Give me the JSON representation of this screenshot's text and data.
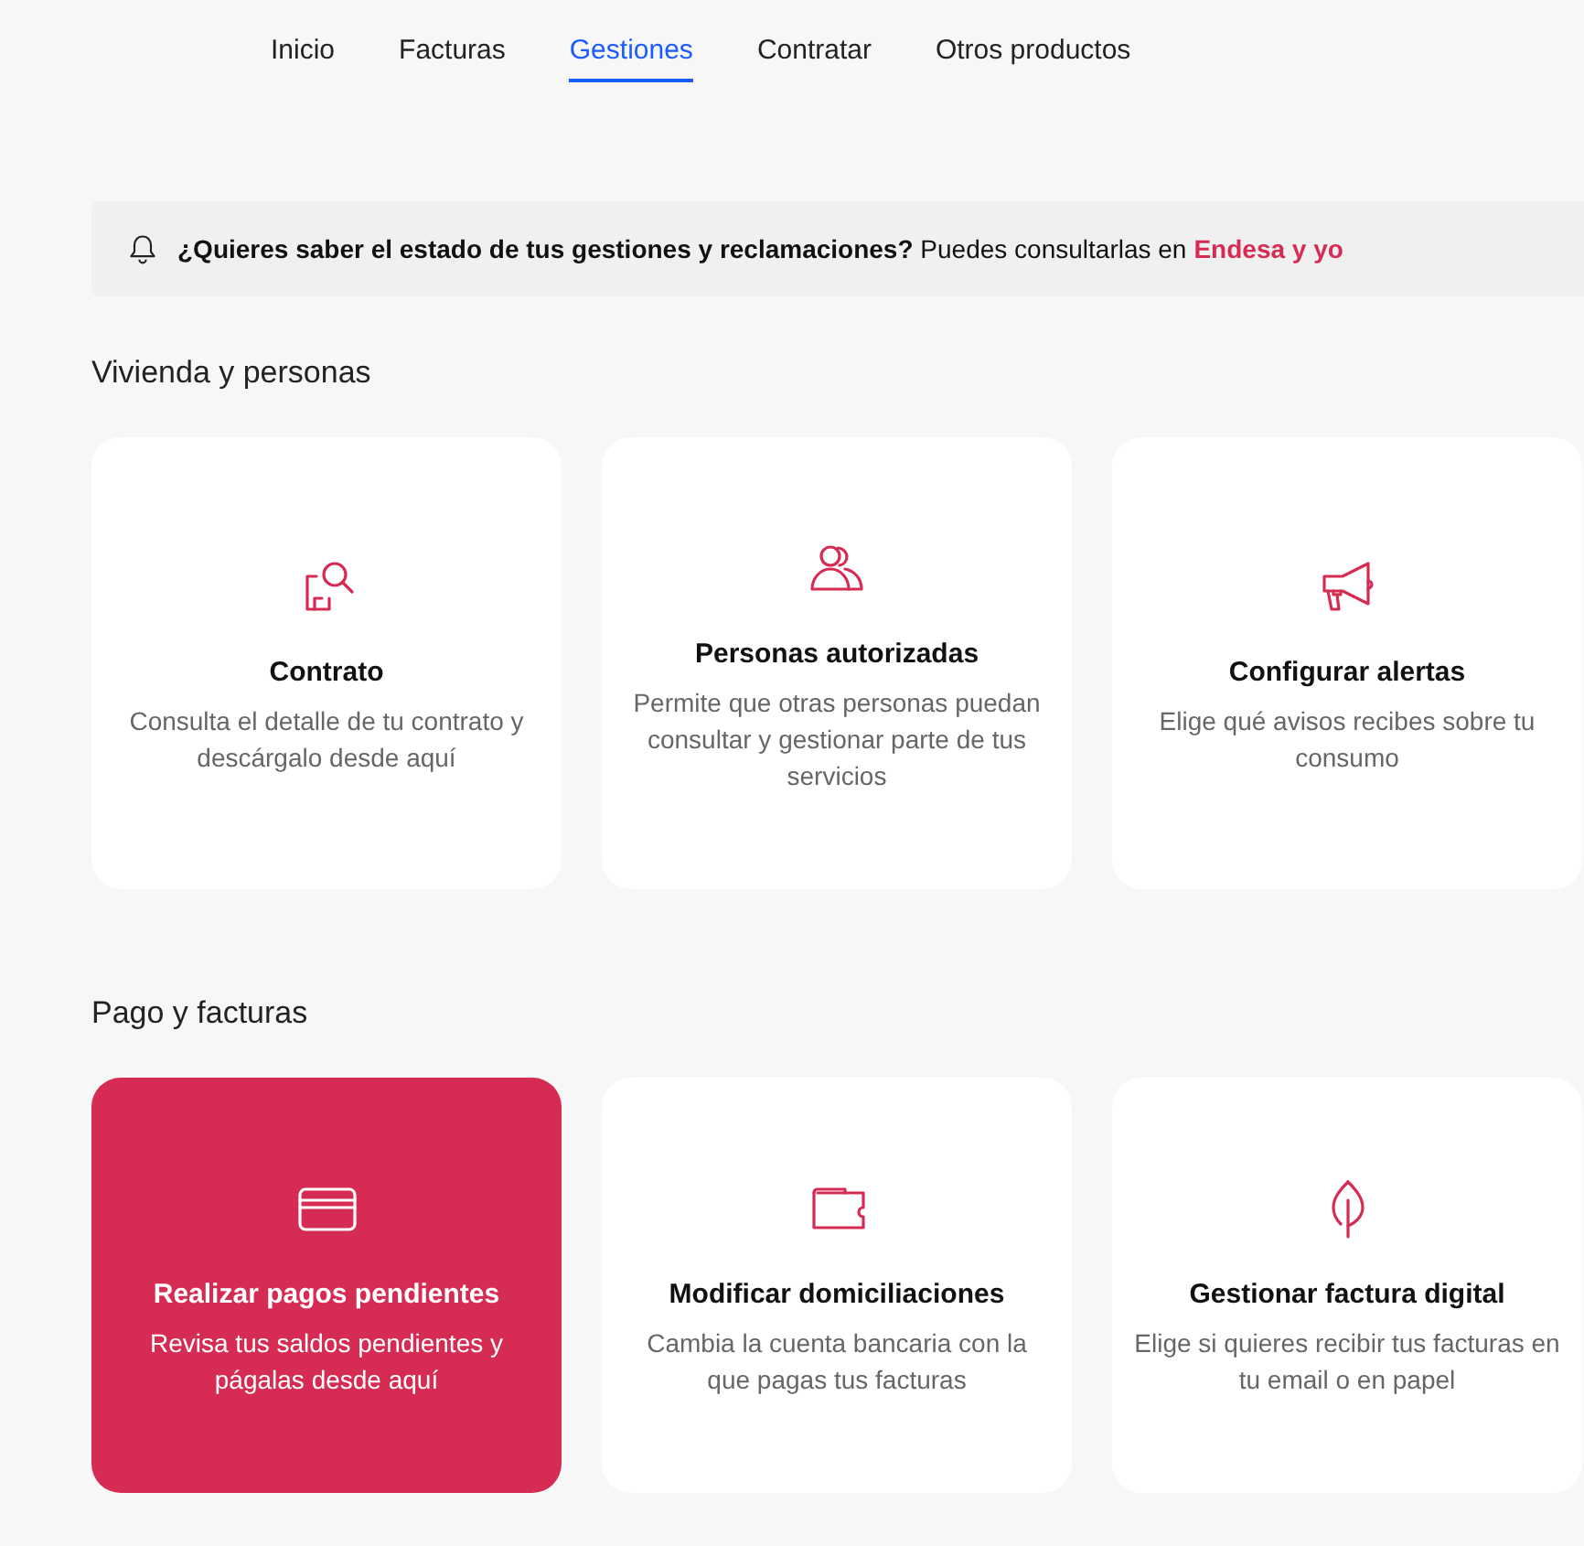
{
  "nav": [
    {
      "label": "Inicio",
      "selected": false
    },
    {
      "label": "Facturas",
      "selected": false
    },
    {
      "label": "Gestiones",
      "selected": true
    },
    {
      "label": "Contratar",
      "selected": false
    },
    {
      "label": "Otros productos",
      "selected": false
    }
  ],
  "notice": {
    "text": "**¿Quieres saber el estado de tus gestiones y reclamaciones?** Puedes consultarlas en",
    "link": "Endesa y yo"
  },
  "sections": [
    {
      "title": "Vivienda y personas",
      "cards": [
        {
          "kind": "contract",
          "title": "Contrato",
          "description": "Consulta el detalle de tu contrato y descárgalo desde aquí",
          "selected": false
        },
        {
          "kind": "people",
          "title": "Personas autorizadas",
          "description": "Permite que otras personas puedan consultar y gestionar parte de tus servicios",
          "selected": false
        },
        {
          "kind": "megaphone",
          "title": "Configurar alertas",
          "description": "Elige qué avisos recibes sobre tu consumo",
          "selected": false
        }
      ]
    },
    {
      "title": "Pago y facturas",
      "cards": [
        {
          "kind": "card",
          "title": "Realizar pagos pendientes",
          "description": "Revisa tus saldos pendientes y págalas desde aquí",
          "selected": true
        },
        {
          "kind": "wallet",
          "title": "Modificar domiciliaciones",
          "description": "Cambia la cuenta bancaria con la que pagas tus facturas",
          "selected": false
        },
        {
          "kind": "leaf",
          "title": "Gestionar factura digital",
          "description": "Elige si quieres recibir tus facturas en tu email o en papel",
          "selected": false
        }
      ]
    }
  ]
}
